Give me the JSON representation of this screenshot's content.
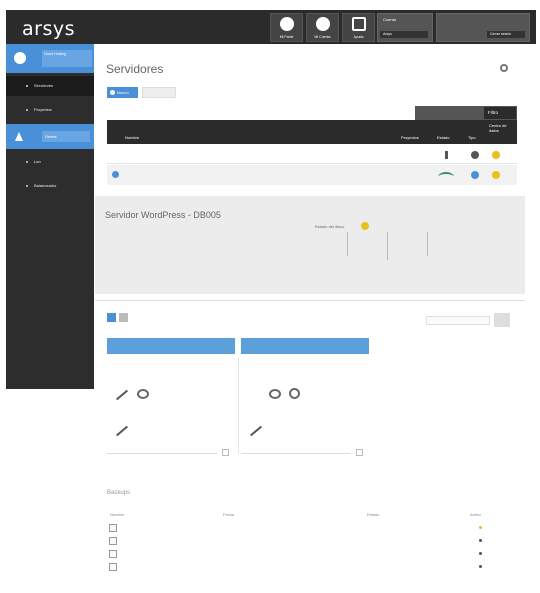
{
  "header": {
    "logo": "arsys",
    "buttons": [
      {
        "label": "Mi Panel"
      },
      {
        "label": "Mi Cuenta"
      },
      {
        "label": "Ayuda"
      }
    ],
    "account": {
      "line1": "Cuenta",
      "line2": "",
      "select": "Arsys"
    },
    "user": {
      "line1": "",
      "line2": "",
      "logout": "Cerrar sesión"
    }
  },
  "sidebar": {
    "header_label": "Cloud Hosting",
    "items": [
      {
        "label": "Servidores"
      },
      {
        "label": "Proyectos"
      },
      {
        "label": "Redes"
      },
      {
        "label": "Lan"
      },
      {
        "label": "Balanceador"
      }
    ],
    "footer": [
      "",
      "",
      ""
    ]
  },
  "main": {
    "title": "Servidores",
    "new_button": "Nuevo",
    "secondary_button": "",
    "filter_button": "Filtro",
    "table_headers": [
      "Nombre",
      "Proyectos",
      "Estado",
      "Tipo",
      "Centro de datos"
    ],
    "rows": [
      {
        "name": "",
        "status_color": "#555555",
        "type_color": "#e8c020"
      },
      {
        "name": "",
        "status_color": "#3a8a7a",
        "type_color": "#e8c020"
      }
    ]
  },
  "detail": {
    "name": "Servidor WordPress - DB005",
    "line1": "",
    "line2": "",
    "state_label": "Estado del disco",
    "labels": [
      "",
      "",
      "",
      ""
    ],
    "notes": [
      "",
      ""
    ]
  },
  "cards_panel": {
    "search_placeholder": "",
    "cards": [
      {
        "title": "",
        "sub": "",
        "l1": "",
        "l2": ""
      },
      {
        "title": "",
        "sub": "",
        "l1": "",
        "l2": ""
      }
    ]
  },
  "bottom": {
    "title": "Backups",
    "headers": [
      "Nombre",
      "Fecha",
      "Estado",
      "Activo"
    ],
    "rows": [
      {
        "name": "",
        "date": "",
        "state": "",
        "status_color": "#e8c020"
      },
      {
        "name": "",
        "date": "",
        "state": "",
        "status_color": "#555555"
      },
      {
        "name": "",
        "date": "",
        "state": "",
        "status_color": "#555555"
      },
      {
        "name": "",
        "date": "",
        "state": "",
        "status_color": "#555555"
      }
    ]
  },
  "colors": {
    "accent": "#4a90d9",
    "topbar": "#2b2b2b",
    "sidebar": "#2d2d2d",
    "status_yellow": "#e8c020",
    "status_green": "#3a8a7a"
  }
}
